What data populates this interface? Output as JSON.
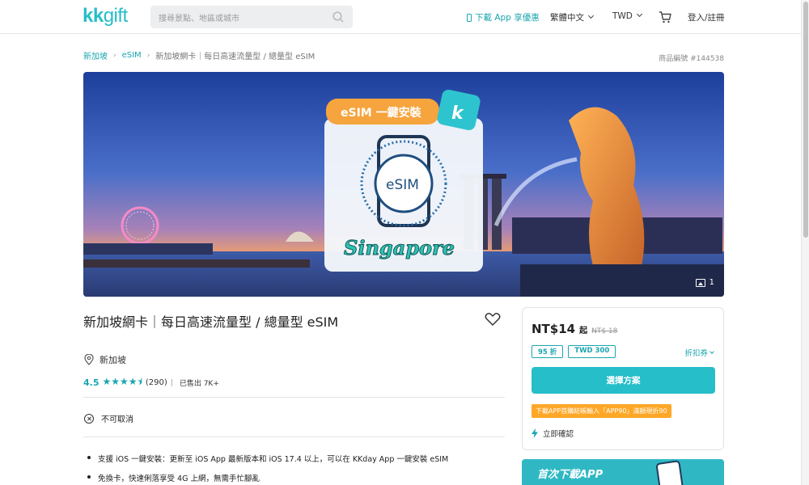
{
  "header": {
    "logo_kk": "kk",
    "logo_gift": "gift",
    "search_placeholder": "搜尋景點、地區或城市",
    "download_app": "下載 App 享優惠",
    "language": "繁體中文",
    "currency": "TWD",
    "login": "登入/註冊"
  },
  "breadcrumb": {
    "items": [
      "新加坡",
      "eSIM"
    ],
    "current": "新加坡網卡｜每日高速流量型 / 總量型 eSIM"
  },
  "product_id": "商品編號 #144538",
  "hero": {
    "badge": "eSIM 一鍵安裝",
    "badge_k": "k",
    "chip_label": "eSIM",
    "country": "Singapore",
    "image_count": "1"
  },
  "product": {
    "title": "新加坡網卡｜每日高速流量型 / 總量型 eSIM",
    "location": "新加坡",
    "score": "4.5",
    "stars": "★★★★⯨",
    "reviews": "(290)",
    "sold": "已售出 7K+",
    "cancel_policy": "不可取消",
    "bullets": [
      "支援 iOS 一鍵安裝：更新至 iOS App 最新版本和 iOS 17.4 以上，可以在 KKday App 一鍵安裝 eSIM",
      "免換卡，快速俐落享受 4G 上網，無需手忙腳亂"
    ]
  },
  "pricing": {
    "price": "NT$14",
    "price_suffix": "起",
    "original_price": "NT$ 18",
    "tags": [
      "95 折",
      "TWD 300"
    ],
    "coupon": "折扣券",
    "select_button": "選擇方案",
    "promo": "下載APP首購結帳輸入「APP90」滿額現折90",
    "instant_confirm": "立即確認"
  },
  "banner": {
    "line1": "首次下載APP"
  },
  "colors": {
    "brand": "#26bec9",
    "brand_text": "#1aa6b0",
    "promo": "#ffa726"
  }
}
